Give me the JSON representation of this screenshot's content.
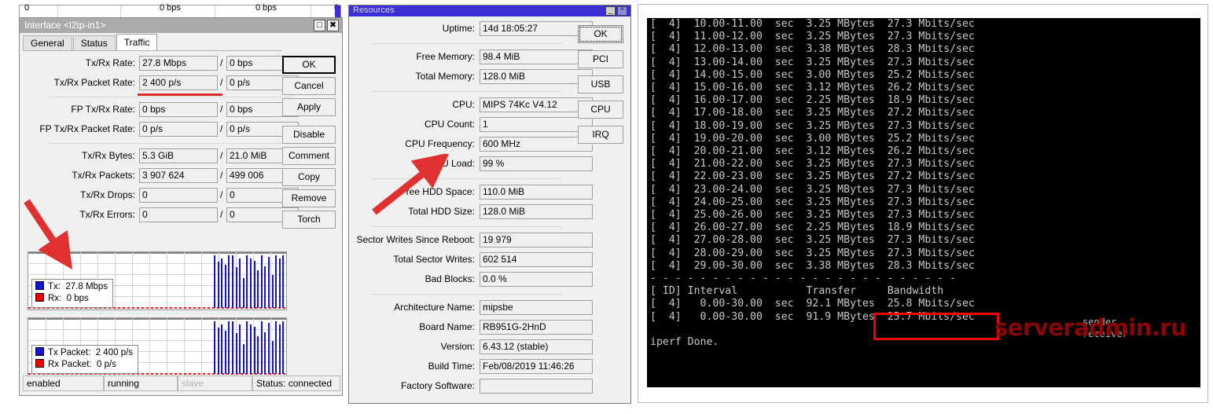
{
  "background_window": {
    "row_cells": [
      "0",
      "0 bps",
      "0 bps",
      "0"
    ]
  },
  "interface_window": {
    "title": "Interface <l2tp-in1>",
    "restore_icon": "restore-icon",
    "close_icon": "close-icon",
    "tabs": [
      {
        "label": "General",
        "active": false
      },
      {
        "label": "Status",
        "active": false
      },
      {
        "label": "Traffic",
        "active": true
      }
    ],
    "fields": [
      {
        "label": "Tx/Rx Rate:",
        "tx": "27.8 Mbps",
        "rx": "0 bps",
        "group": 1,
        "highlight": true
      },
      {
        "label": "Tx/Rx Packet Rate:",
        "tx": "2 400 p/s",
        "rx": "0 p/s",
        "group": 1
      },
      {
        "label": "FP Tx/Rx Rate:",
        "tx": "0 bps",
        "rx": "0 bps",
        "group": 2
      },
      {
        "label": "FP Tx/Rx Packet Rate:",
        "tx": "0 p/s",
        "rx": "0 p/s",
        "group": 2
      },
      {
        "label": "Tx/Rx Bytes:",
        "tx": "5.3 GiB",
        "rx": "21.0 MiB",
        "group": 3
      },
      {
        "label": "Tx/Rx Packets:",
        "tx": "3 907 624",
        "rx": "499 006",
        "group": 3
      },
      {
        "label": "Tx/Rx Drops:",
        "tx": "0",
        "rx": "0",
        "group": 3
      },
      {
        "label": "Tx/Rx Errors:",
        "tx": "0",
        "rx": "0",
        "group": 3
      }
    ],
    "separator": "/",
    "buttons": [
      {
        "label": "OK",
        "style": "default"
      },
      {
        "label": "Cancel",
        "style": "normal"
      },
      {
        "label": "Apply",
        "style": "normal"
      },
      {
        "label": "Disable",
        "style": "normal",
        "gap_before": true
      },
      {
        "label": "Comment",
        "style": "normal"
      },
      {
        "label": "Copy",
        "style": "normal"
      },
      {
        "label": "Remove",
        "style": "normal"
      },
      {
        "label": "Torch",
        "style": "normal"
      }
    ],
    "graphs": [
      {
        "name": "rate-graph",
        "legend": [
          {
            "color": "#1414d2",
            "label": "Tx:",
            "value": "27.8 Mbps"
          },
          {
            "color": "#ee0000",
            "label": "Rx:",
            "value": "0 bps"
          }
        ]
      },
      {
        "name": "packet-graph",
        "legend": [
          {
            "color": "#1414d2",
            "label": "Tx Packet:",
            "value": "2 400 p/s"
          },
          {
            "color": "#ee0000",
            "label": "Rx Packet:",
            "value": "0 p/s"
          }
        ]
      }
    ],
    "status_bar": [
      {
        "text": "enabled",
        "dim": false
      },
      {
        "text": "running",
        "dim": false
      },
      {
        "text": "slave",
        "dim": true
      },
      {
        "text": "Status: connected",
        "dim": false
      }
    ]
  },
  "resources_window": {
    "title": "Resources",
    "minimize_icon": "minimize-icon",
    "close_icon": "close-icon",
    "fields": [
      {
        "label": "Uptime:",
        "value": "14d 18:05:27",
        "group": 1
      },
      {
        "label": "Free Memory:",
        "value": "98.4 MiB",
        "group": 2
      },
      {
        "label": "Total Memory:",
        "value": "128.0 MiB",
        "group": 2
      },
      {
        "label": "CPU:",
        "value": "MIPS 74Kc V4.12",
        "group": 3
      },
      {
        "label": "CPU Count:",
        "value": "1",
        "group": 3
      },
      {
        "label": "CPU Frequency:",
        "value": "600 MHz",
        "group": 3
      },
      {
        "label": "CPU Load:",
        "value": "99 %",
        "group": 3,
        "highlight": true
      },
      {
        "label": "Free HDD Space:",
        "value": "110.0 MiB",
        "group": 4
      },
      {
        "label": "Total HDD Size:",
        "value": "128.0 MiB",
        "group": 4
      },
      {
        "label": "Sector Writes Since Reboot:",
        "value": "19 979",
        "group": 5
      },
      {
        "label": "Total Sector Writes:",
        "value": "602 514",
        "group": 5
      },
      {
        "label": "Bad Blocks:",
        "value": "0.0 %",
        "group": 5
      },
      {
        "label": "Architecture Name:",
        "value": "mipsbe",
        "group": 6
      },
      {
        "label": "Board Name:",
        "value": "RB951G-2HnD",
        "group": 6
      },
      {
        "label": "Version:",
        "value": "6.43.12 (stable)",
        "group": 6
      },
      {
        "label": "Build Time:",
        "value": "Feb/08/2019 11:46:26",
        "group": 6
      },
      {
        "label": "Factory Software:",
        "value": "",
        "group": 6
      }
    ],
    "buttons": [
      {
        "label": "OK",
        "style": "dotted"
      },
      {
        "label": "PCI",
        "style": "normal"
      },
      {
        "label": "USB",
        "style": "normal"
      },
      {
        "label": "CPU",
        "style": "normal"
      },
      {
        "label": "IRQ",
        "style": "normal"
      }
    ]
  },
  "terminal": {
    "text": "[  4]  10.00-11.00  sec  3.25 MBytes  27.3 Mbits/sec\n[  4]  11.00-12.00  sec  3.25 MBytes  27.3 Mbits/sec\n[  4]  12.00-13.00  sec  3.38 MBytes  28.3 Mbits/sec\n[  4]  13.00-14.00  sec  3.25 MBytes  27.3 Mbits/sec\n[  4]  14.00-15.00  sec  3.00 MBytes  25.2 Mbits/sec\n[  4]  15.00-16.00  sec  3.12 MBytes  26.2 Mbits/sec\n[  4]  16.00-17.00  sec  2.25 MBytes  18.9 Mbits/sec\n[  4]  17.00-18.00  sec  3.25 MBytes  27.2 Mbits/sec\n[  4]  18.00-19.00  sec  3.25 MBytes  27.3 Mbits/sec\n[  4]  19.00-20.00  sec  3.00 MBytes  25.2 Mbits/sec\n[  4]  20.00-21.00  sec  3.12 MBytes  26.2 Mbits/sec\n[  4]  21.00-22.00  sec  3.25 MBytes  27.3 Mbits/sec\n[  4]  22.00-23.00  sec  3.25 MBytes  27.2 Mbits/sec\n[  4]  23.00-24.00  sec  3.25 MBytes  27.3 Mbits/sec\n[  4]  24.00-25.00  sec  3.25 MBytes  27.3 Mbits/sec\n[  4]  25.00-26.00  sec  3.25 MBytes  27.3 Mbits/sec\n[  4]  26.00-27.00  sec  2.25 MBytes  18.9 Mbits/sec\n[  4]  27.00-28.00  sec  3.25 MBytes  27.3 Mbits/sec\n[  4]  28.00-29.00  sec  3.25 MBytes  27.3 Mbits/sec\n[  4]  29.00-30.00  sec  3.38 MBytes  28.3 Mbits/sec\n- - - - - - - - - - - - - - - - - - - - - - - - -\n[ ID] Interval           Transfer     Bandwidth\n[  4]   0.00-30.00  sec  92.1 MBytes  25.8 Mbits/sec\n[  4]   0.00-30.00  sec  91.9 MBytes  25.7 Mbits/sec\n\niperf Done.",
    "sender_label": "sender",
    "receiver_label": "receiver",
    "watermark": "serveradmin.ru",
    "highlight_color": "#f00000"
  }
}
